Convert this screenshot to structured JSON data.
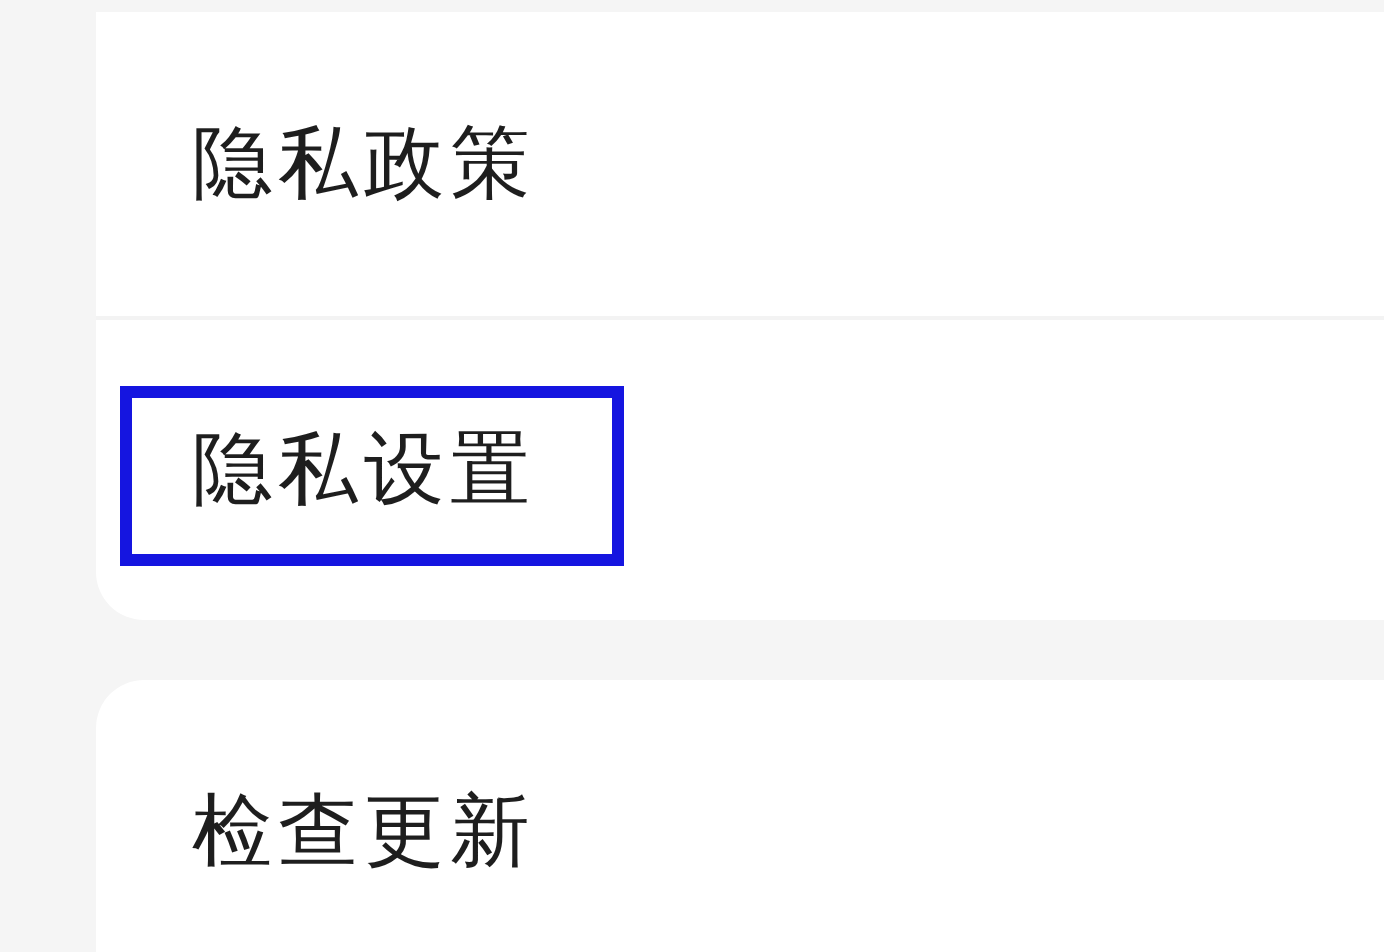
{
  "groups": [
    {
      "items": [
        {
          "label": "隐私政策",
          "highlighted": false
        },
        {
          "label": "隐私设置",
          "highlighted": true
        }
      ]
    },
    {
      "items": [
        {
          "label": "检查更新",
          "highlighted": false
        }
      ]
    }
  ]
}
